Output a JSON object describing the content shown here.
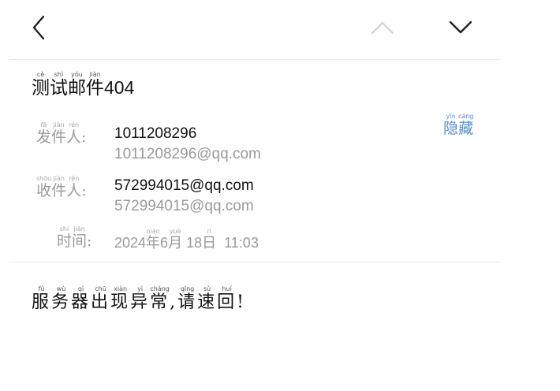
{
  "toolbar": {
    "back_icon": "chevron-left-icon",
    "prev_icon": "chevron-up-icon",
    "next_icon": "chevron-down-icon",
    "back_color": "#222222",
    "prev_color": "#cfcfcf",
    "next_color": "#222222"
  },
  "mail": {
    "subject": {
      "chars": [
        {
          "h": "测",
          "p": "cè"
        },
        {
          "h": "试",
          "p": "shì"
        },
        {
          "h": "邮",
          "p": "yóu"
        },
        {
          "h": "件",
          "p": "jiàn"
        }
      ],
      "number": "404"
    },
    "hide": {
      "chars": [
        {
          "h": "隐",
          "p": "yǐn"
        },
        {
          "h": "藏",
          "p": "cáng"
        }
      ],
      "color": "#5b8fc7"
    },
    "sender": {
      "label": [
        {
          "h": "发",
          "p": "fā"
        },
        {
          "h": "件",
          "p": "jiàn"
        },
        {
          "h": "人",
          "p": "rén"
        }
      ],
      "colon": ":",
      "name": "1011208296",
      "email": "1011208296@qq.com"
    },
    "recipient": {
      "label": [
        {
          "h": "收",
          "p": "shōu"
        },
        {
          "h": "件",
          "p": "jiàn"
        },
        {
          "h": "人",
          "p": "rén"
        }
      ],
      "colon": ":",
      "name": "572994015@qq.com",
      "email": "572994015@qq.com"
    },
    "time": {
      "label": [
        {
          "h": "时",
          "p": "shí"
        },
        {
          "h": "间",
          "p": "jiān"
        }
      ],
      "colon": ":",
      "year": "2024",
      "year_char": {
        "h": "年",
        "p": "nián"
      },
      "month": "6",
      "month_char": {
        "h": "月",
        "p": "yuè"
      },
      "day": "18",
      "day_char": {
        "h": "日",
        "p": "rì"
      },
      "clock": "11:03"
    },
    "body": [
      {
        "h": "服",
        "p": "fú"
      },
      {
        "h": "务",
        "p": "wù"
      },
      {
        "h": "器",
        "p": "qì"
      },
      {
        "h": "出",
        "p": "chū"
      },
      {
        "h": "现",
        "p": "xiàn"
      },
      {
        "h": "异",
        "p": "yì"
      },
      {
        "h": "常",
        "p": "cháng"
      },
      {
        "h": ",",
        "p": ""
      },
      {
        "h": "请",
        "p": "qǐng"
      },
      {
        "h": "速",
        "p": "sù"
      },
      {
        "h": "回",
        "p": "huí"
      },
      {
        "h": "!",
        "p": ""
      }
    ]
  }
}
